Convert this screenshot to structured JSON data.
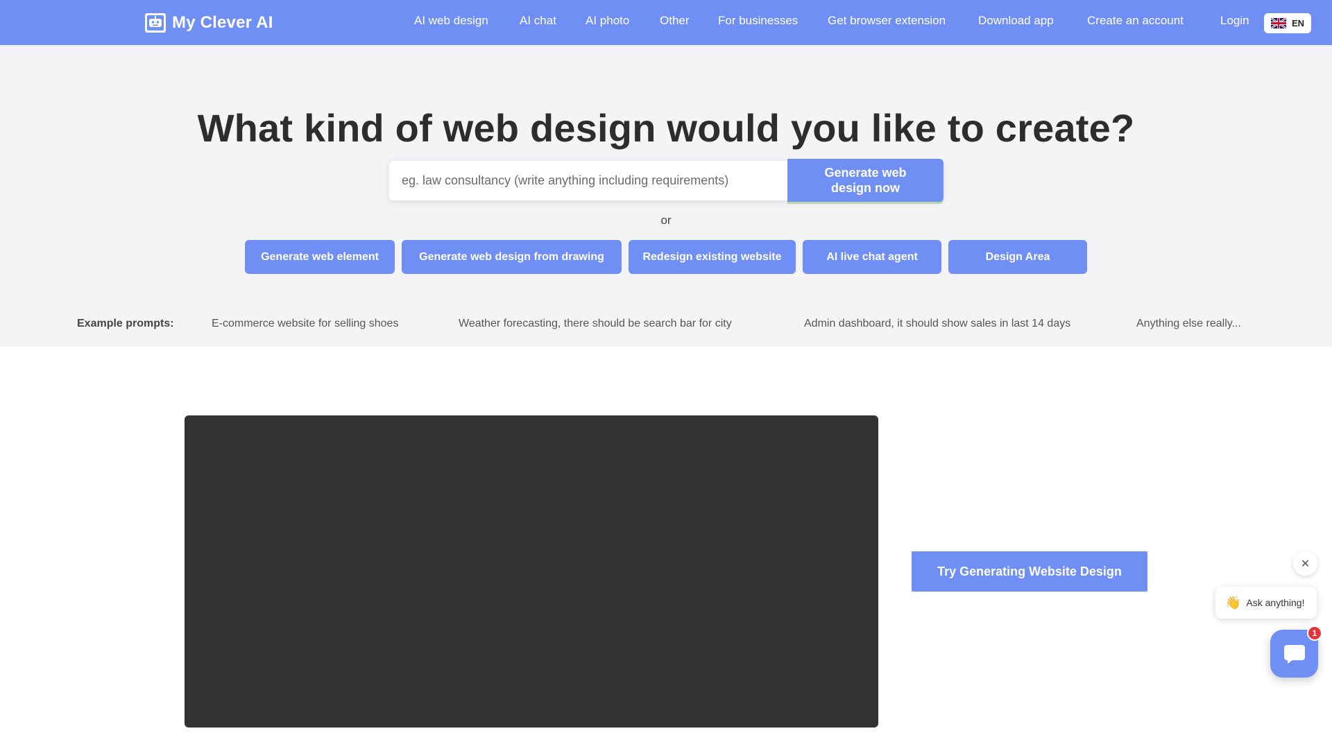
{
  "brand": {
    "name": "My Clever AI"
  },
  "nav": {
    "items": [
      "AI web design",
      "AI chat",
      "AI photo",
      "Other",
      "For businesses",
      "Get browser extension",
      "Download app",
      "Create an account",
      "Login"
    ],
    "language": "EN"
  },
  "hero": {
    "title": "What kind of web design would you like to create?",
    "search": {
      "placeholder": "eg. law consultancy (write anything including requirements)",
      "value": ""
    },
    "generate_button": "Generate web design now",
    "or_text": "or",
    "actions": [
      "Generate web element",
      "Generate web design from drawing",
      "Redesign existing website",
      "AI live chat agent",
      "Design Area"
    ],
    "examples": {
      "label": "Example prompts:",
      "items": [
        "E-commerce website for selling shoes",
        "Weather forecasting, there should be search bar for city",
        "Admin dashboard, it should show sales in last 14 days",
        "Anything else really..."
      ]
    }
  },
  "main": {
    "try_button": "Try Generating Website Design"
  },
  "chat_widget": {
    "close_glyph": "✕",
    "wave": "👋",
    "prompt": "Ask anything!",
    "unread_count": "1"
  },
  "colors": {
    "accent": "#6f8ff5",
    "hero_bg": "#f4f4f6",
    "dark_panel": "#333333",
    "badge": "#e0353b"
  }
}
